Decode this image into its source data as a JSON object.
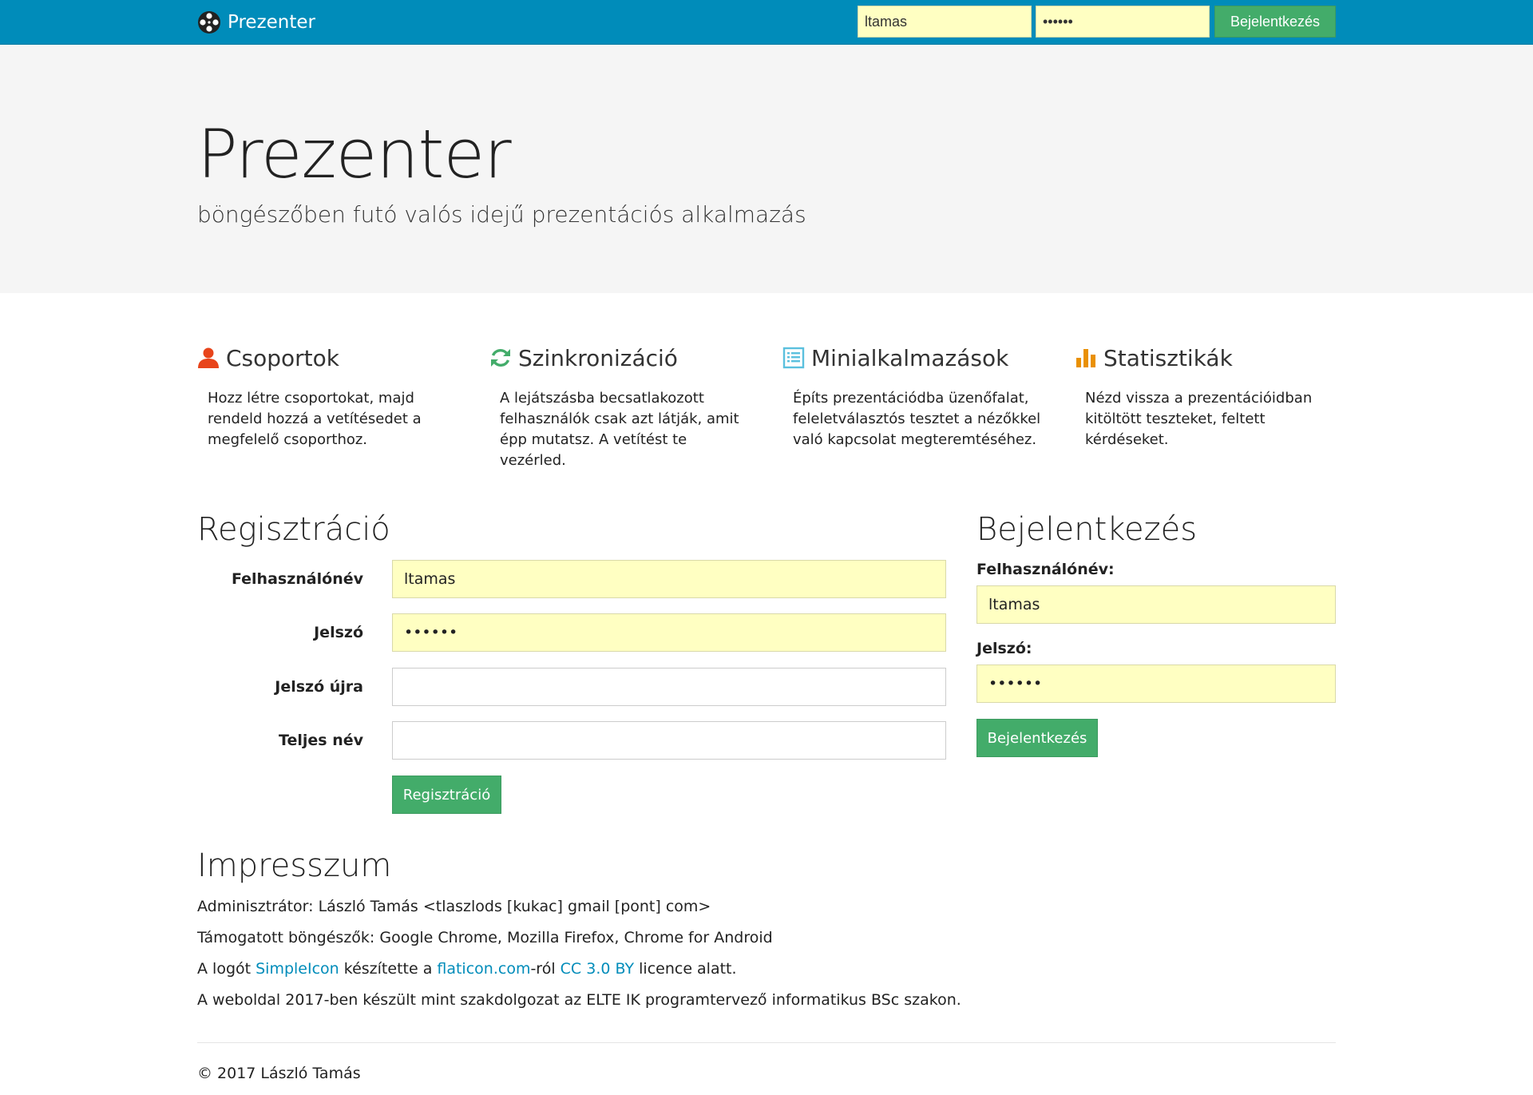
{
  "navbar": {
    "brand": "Prezenter",
    "username_value": "ltamas",
    "password_value": "••••••",
    "login_button": "Bejelentkezés"
  },
  "jumbotron": {
    "title": "Prezenter",
    "subtitle": "böngészőben futó valós idejű prezentációs alkalmazás"
  },
  "features": [
    {
      "icon": "user-icon",
      "title": "Csoportok",
      "text": "Hozz létre csoportokat, majd rendeld hozzá a vetítésedet a megfelelő csoporthoz.",
      "color": "#e8441b"
    },
    {
      "icon": "refresh-icon",
      "title": "Szinkronizáció",
      "text": "A lejátszásba becsatlakozott felhasználók csak azt látják, amit épp mutatsz. A vetítést te vezérled.",
      "color": "#43ac6a"
    },
    {
      "icon": "list-icon",
      "title": "Minialkalmazások",
      "text": "Építs prezentációdba üzenőfalat, feleletválasztós tesztet a nézőkkel való kapcsolat megteremtéséhez.",
      "color": "#5bc0de"
    },
    {
      "icon": "bar-chart-icon",
      "title": "Statisztikák",
      "text": "Nézd vissza a prezentációidban kitöltött teszteket, feltett kérdéseket.",
      "color": "#e99002"
    }
  ],
  "registration": {
    "title": "Regisztráció",
    "username_label": "Felhasználónév",
    "username_value": "ltamas",
    "password_label": "Jelszó",
    "password_value": "••••••",
    "password_again_label": "Jelszó újra",
    "password_again_value": "",
    "fullname_label": "Teljes név",
    "fullname_value": "",
    "submit": "Regisztráció"
  },
  "login": {
    "title": "Bejelentkezés",
    "username_label": "Felhasználónév:",
    "username_value": "ltamas",
    "password_label": "Jelszó:",
    "password_value": "••••••",
    "submit": "Bejelentkezés"
  },
  "impressum": {
    "title": "Impresszum",
    "admin": "Adminisztrátor: László Tamás <tlaszlods [kukac] gmail [pont] com>",
    "browsers": "Támogatott böngészők: Google Chrome, Mozilla Firefox, Chrome for Android",
    "logo_prefix": "A logót ",
    "logo_link1": "SimpleIcon",
    "logo_mid1": " készítette a ",
    "logo_link2": "flaticon.com",
    "logo_mid2": "-ról ",
    "logo_link3": "CC 3.0 BY",
    "logo_suffix": " licence alatt.",
    "thesis": "A weboldal 2017-ben készült mint szakdolgozat az ELTE IK programtervező informatikus BSc szakon."
  },
  "footer": {
    "copyright": "© 2017 László Tamás"
  },
  "colors": {
    "navbar": "#008cba",
    "button": "#43ac6a",
    "autofill": "#ffffc2",
    "link": "#008cba"
  }
}
